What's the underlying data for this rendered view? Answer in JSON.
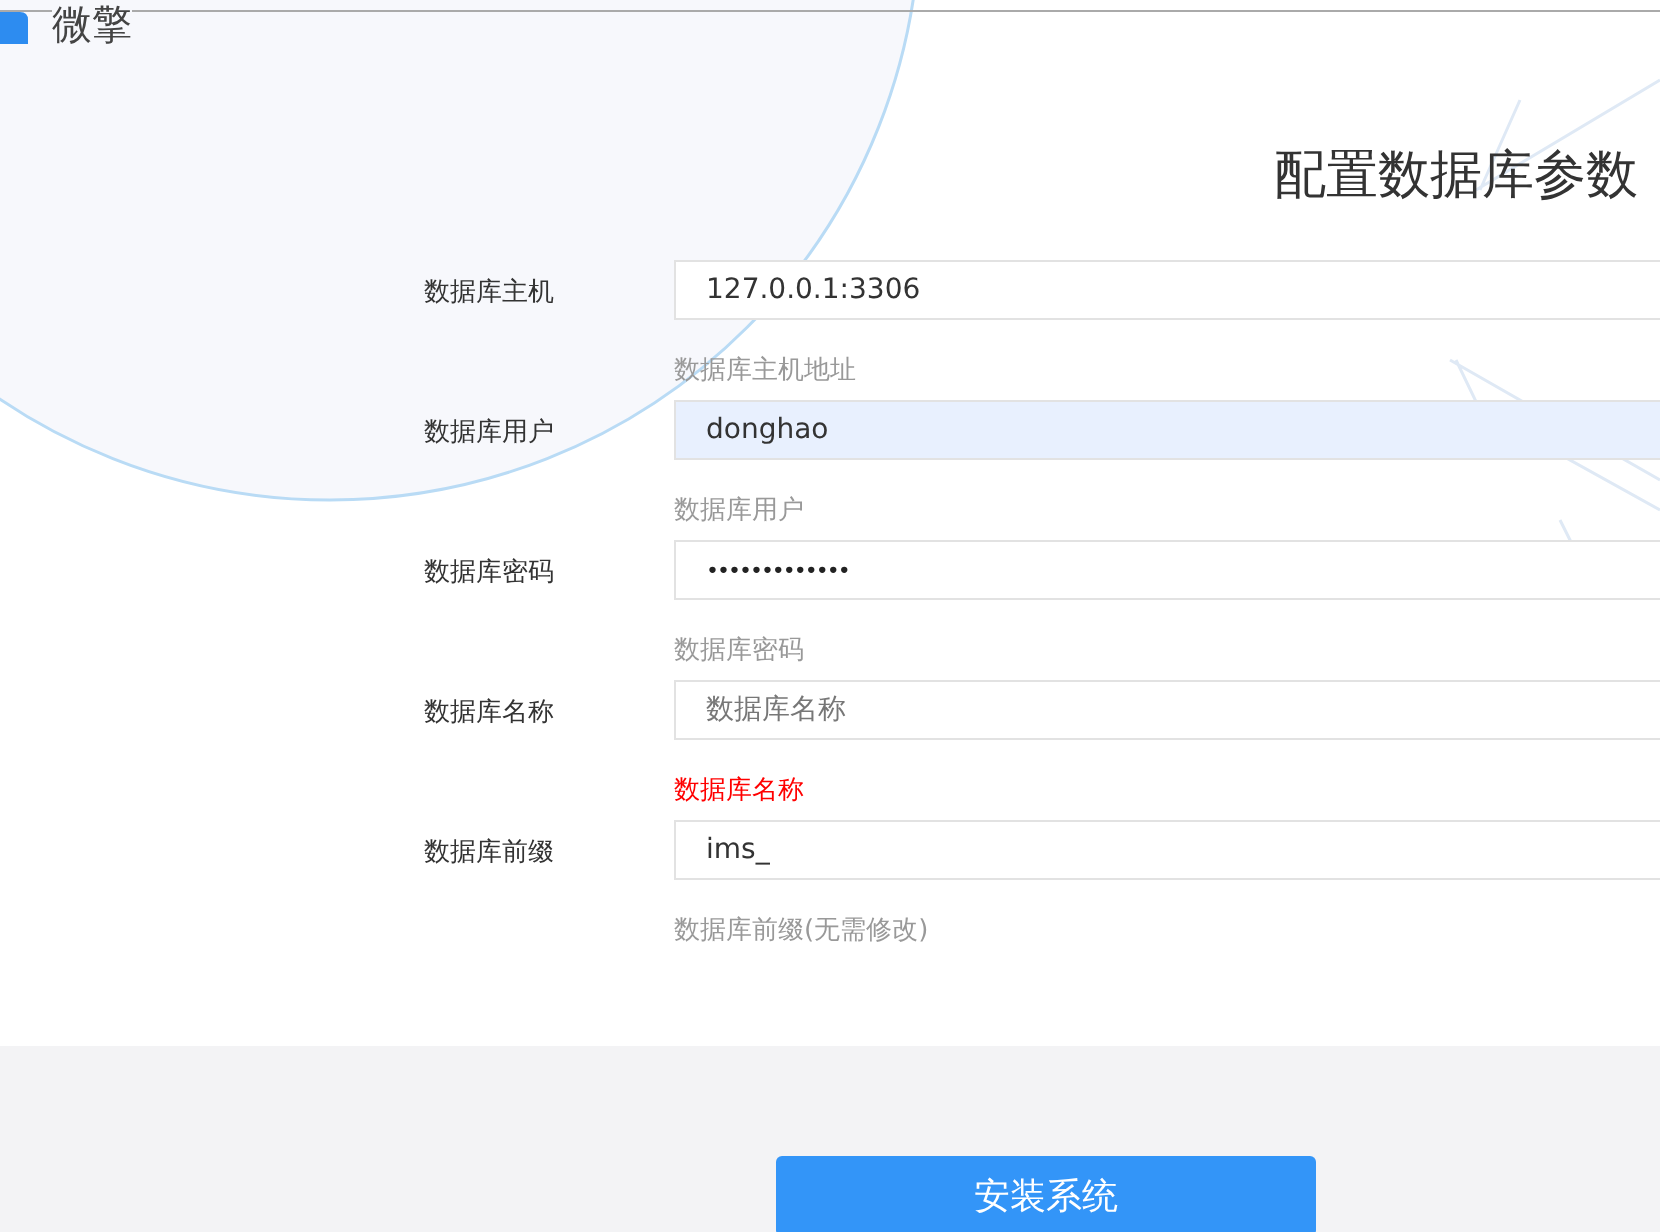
{
  "logo": {
    "text": "微擎"
  },
  "heading": "配置数据库参数",
  "fields": [
    {
      "label": "数据库主机",
      "kind": "text",
      "value": "127.0.0.1:3306",
      "autofilled": false,
      "hint": "数据库主机地址",
      "error": false
    },
    {
      "label": "数据库用户",
      "kind": "text",
      "value": "donghao",
      "autofilled": true,
      "hint": "数据库用户",
      "error": false
    },
    {
      "label": "数据库密码",
      "kind": "password",
      "value": "•••••••••••••",
      "autofilled": false,
      "hint": "数据库密码",
      "error": false
    },
    {
      "label": "数据库名称",
      "kind": "text",
      "placeholder": "数据库名称",
      "autofilled": false,
      "hint": "数据库名称",
      "error": true
    },
    {
      "label": "数据库前缀",
      "kind": "text",
      "value": "ims_",
      "autofilled": false,
      "hint": "数据库前缀(无需修改)",
      "error": false
    }
  ],
  "button": "安装系统"
}
